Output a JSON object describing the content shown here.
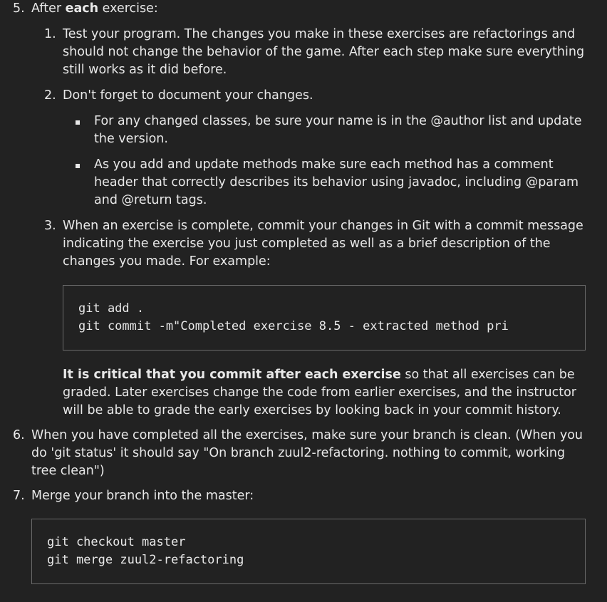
{
  "item5": {
    "number": "5.",
    "intro_pre": "After ",
    "intro_bold": "each",
    "intro_post": " exercise:",
    "sub": [
      {
        "number": "1.",
        "text": "Test your program. The changes you make in these exercises are refactorings and should not change the behavior of the game. After each step make sure everything still works as it did before."
      },
      {
        "number": "2.",
        "text": "Don't forget to document your changes."
      },
      {
        "number": "3.",
        "text": "When an exercise is complete, commit your changes in Git with a commit message indicating the exercise you just completed as well as a brief description of the changes you made. For example:"
      }
    ],
    "bullets": [
      "For any changed classes, be sure your name is in the @author list and update the version.",
      "As you add and update methods make sure each method has a comment header that correctly describes its behavior using javadoc, including @param and @return tags."
    ],
    "code1_line1": "git add .",
    "code1_line2": "git commit -m\"Completed exercise 8.5 - extracted method pri",
    "critical_bold": "It is critical that you commit after each exercise",
    "critical_rest": " so that all exercises can be graded. Later exercises change the code from earlier exercises, and the instructor will be able to grade the early exercises by looking back in your commit history."
  },
  "item6": {
    "number": "6.",
    "text": "When you have completed all the exercises, make sure your branch is clean. (When you do 'git status' it should say \"On branch zuul2-refactoring. nothing to commit, working tree clean\")"
  },
  "item7": {
    "number": "7.",
    "text": "Merge your branch into the master:",
    "code_line1": "git checkout master",
    "code_line2": "git merge zuul2-refactoring"
  }
}
